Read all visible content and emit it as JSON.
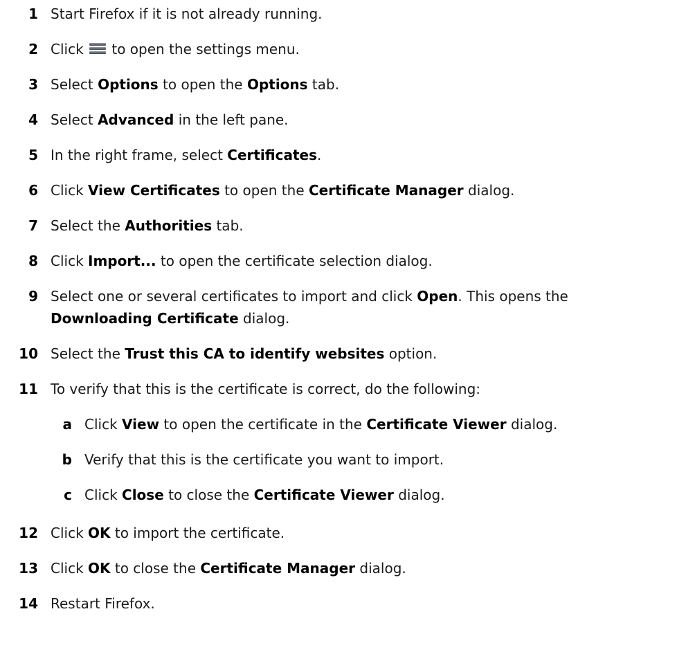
{
  "steps": [
    {
      "num": "1",
      "parts": [
        "Start Firefox if it is not already running."
      ]
    },
    {
      "num": "2",
      "pre": "Click",
      "post": "to open the settings menu.",
      "icon": "menu-icon"
    },
    {
      "num": "3",
      "parts": [
        "Select ",
        "Options",
        " to open the ",
        "Options",
        " tab."
      ]
    },
    {
      "num": "4",
      "parts": [
        "Select ",
        "Advanced",
        " in the left pane."
      ]
    },
    {
      "num": "5",
      "parts": [
        "In the right frame, select ",
        "Certificates",
        "."
      ]
    },
    {
      "num": "6",
      "parts": [
        "Click ",
        "View Certificates",
        " to open the ",
        "Certificate Manager",
        " dialog."
      ]
    },
    {
      "num": "7",
      "parts": [
        "Select the ",
        "Authorities",
        " tab."
      ]
    },
    {
      "num": "8",
      "parts": [
        "Click ",
        "Import...",
        " to open the certificate selection dialog."
      ]
    },
    {
      "num": "9",
      "line1": [
        "Select one or several certificates to import and click ",
        "Open",
        ". This opens the"
      ],
      "line2": [
        "Downloading Certificate",
        " dialog."
      ]
    },
    {
      "num": "10",
      "parts": [
        "Select the ",
        "Trust this CA to identify websites",
        " option."
      ]
    },
    {
      "num": "11",
      "parts": [
        "To verify that this is the certificate is correct, do the following:"
      ]
    },
    {
      "num": "a",
      "parts": [
        "Click ",
        "View",
        " to open the certificate in the ",
        "Certificate Viewer",
        " dialog."
      ]
    },
    {
      "num": "b",
      "parts": [
        "Verify that this is the certificate you want to import."
      ]
    },
    {
      "num": "c",
      "parts": [
        "Click ",
        "Close",
        " to close the ",
        "Certificate Viewer",
        " dialog."
      ]
    },
    {
      "num": "12",
      "parts": [
        "Click ",
        "OK",
        " to import the certificate."
      ]
    },
    {
      "num": "13",
      "parts": [
        "Click ",
        "OK",
        " to close the ",
        "Certificate Manager",
        " dialog."
      ]
    },
    {
      "num": "14",
      "parts": [
        "Restart Firefox."
      ]
    }
  ]
}
